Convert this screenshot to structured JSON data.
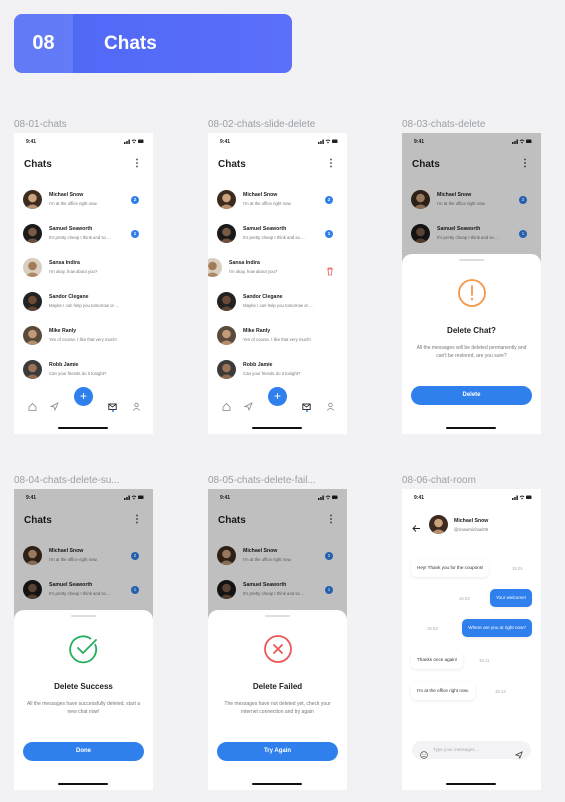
{
  "header": {
    "number": "08",
    "title": "Chats"
  },
  "screens": {
    "s1": {
      "caption": "08-01-chats"
    },
    "s2": {
      "caption": "08-02-chats-slide-delete"
    },
    "s3": {
      "caption": "08-03-chats-delete"
    },
    "s4": {
      "caption": "08-04-chats-delete-su..."
    },
    "s5": {
      "caption": "08-05-chats-delete-fail..."
    },
    "s6": {
      "caption": "08-06-chat-room"
    }
  },
  "status": {
    "time": "9:41"
  },
  "chats_title": "Chats",
  "menu_icon": "⋮",
  "chats": [
    {
      "name": "Michael Snow",
      "message": "I'm at the office right now.",
      "badge": "2"
    },
    {
      "name": "Samuel Seaworth",
      "message": "It's pretty cheap I think and so ...",
      "badge": "1"
    },
    {
      "name": "Sansa Indira",
      "message": "I'm okay, how about you?"
    },
    {
      "name": "Sandor Clegane",
      "message": "Maybe I can help you tomorrow or ..."
    },
    {
      "name": "Mike Ranly",
      "message": "Yes of course. I like that very much!"
    },
    {
      "name": "Robb Jamie",
      "message": "Can your friends do it tonight?"
    }
  ],
  "fab": "+",
  "delete_sheet": {
    "icon": "!",
    "title": "Delete Chat?",
    "desc": "All the messages will be deleted permanently and can't be restored, are you sure?",
    "button": "Delete",
    "color": "#f2994a"
  },
  "success_sheet": {
    "title": "Delete Success",
    "desc": "All the messages have successfully deleted, start a new chat now!",
    "button": "Done",
    "color": "#27ae60"
  },
  "fail_sheet": {
    "title": "Delete Failed",
    "desc": "The messages have not deleted yet, check your internet connection and try again",
    "button": "Try Again",
    "color": "#eb5757"
  },
  "room": {
    "name": "Michael Snow",
    "handle": "@snowmichael09",
    "messages": [
      {
        "text": "Hey! Thank you for the coupons!",
        "time": "15:01",
        "dir": "in"
      },
      {
        "text": "Your welcome!",
        "time": "15:03",
        "dir": "out"
      },
      {
        "text": "Where are you at right now?",
        "time": "15:03",
        "dir": "out"
      },
      {
        "text": "Thanks once again!",
        "time": "15:11",
        "dir": "in"
      },
      {
        "text": "I'm at the office right now.",
        "time": "15:12",
        "dir": "in"
      }
    ],
    "input_placeholder": "Type your messages ..."
  },
  "accent": "#2f80ed"
}
